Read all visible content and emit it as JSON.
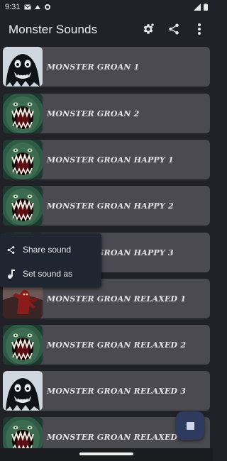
{
  "status_bar": {
    "time": "9:31",
    "left_icons": [
      "mail-icon",
      "cast-icon",
      "sync-icon"
    ],
    "right_icons": [
      "signal-icon",
      "battery-icon"
    ]
  },
  "app_bar": {
    "title": "Monster Sounds",
    "actions": [
      "settings-icon",
      "share-icon",
      "more-vert-icon"
    ]
  },
  "sounds": [
    {
      "label": "MONSTER GROAN 1",
      "thumb": "ghost"
    },
    {
      "label": "MONSTER GROAN 2",
      "thumb": "maw"
    },
    {
      "label": "MONSTER GROAN HAPPY 1",
      "thumb": "maw"
    },
    {
      "label": "MONSTER GROAN HAPPY 2",
      "thumb": "maw"
    },
    {
      "label": "MONSTER GROAN HAPPY 3",
      "thumb": "maw"
    },
    {
      "label": "MONSTER GROAN RELAXED 1",
      "thumb": "creature"
    },
    {
      "label": "MONSTER GROAN RELAXED 2",
      "thumb": "maw"
    },
    {
      "label": "MONSTER GROAN RELAXED 3",
      "thumb": "ghost"
    },
    {
      "label": "MONSTER GROAN RELAXED 4",
      "thumb": "maw"
    }
  ],
  "context_menu": {
    "items": [
      {
        "label": "Share sound",
        "icon": "share-icon"
      },
      {
        "label": "Set sound as",
        "icon": "music-note-icon"
      }
    ]
  },
  "fab": {
    "icon": "stop-icon"
  },
  "colors": {
    "background": "#212227",
    "row": "#4a4a50",
    "popup": "#1f2632",
    "fab": "#2e3a5e"
  }
}
